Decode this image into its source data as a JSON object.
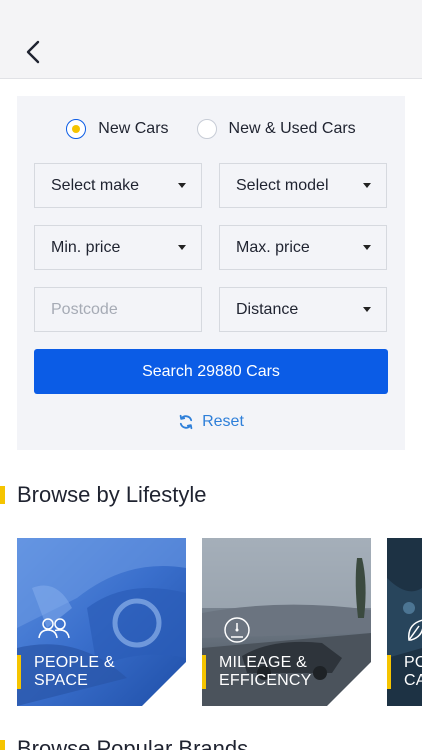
{
  "nav": {
    "back_icon": "chevron-left-icon"
  },
  "search": {
    "radio_options": [
      {
        "label": "New Cars",
        "selected": true
      },
      {
        "label": "New & Used Cars",
        "selected": false
      }
    ],
    "make_select": "Select make",
    "model_select": "Select model",
    "min_price_select": "Min. price",
    "max_price_select": "Max. price",
    "postcode_placeholder": "Postcode",
    "distance_select": "Distance",
    "search_button": "Search 29880 Cars",
    "reset_label": "Reset"
  },
  "lifestyle": {
    "title": "Browse by Lifestyle",
    "tiles": [
      {
        "line1": "PEOPLE &",
        "line2": "SPACE",
        "icon": "people-icon"
      },
      {
        "line1": "MILEAGE &",
        "line2": "EFFICENCY",
        "icon": "speedometer-icon"
      },
      {
        "line1": "PO",
        "line2": "CA",
        "icon": "leaf-icon"
      }
    ]
  },
  "brands": {
    "title": "Browse Popular Brands"
  },
  "colors": {
    "accent": "#f5c400",
    "primary": "#0b5ce6",
    "link": "#2e7fd9"
  }
}
